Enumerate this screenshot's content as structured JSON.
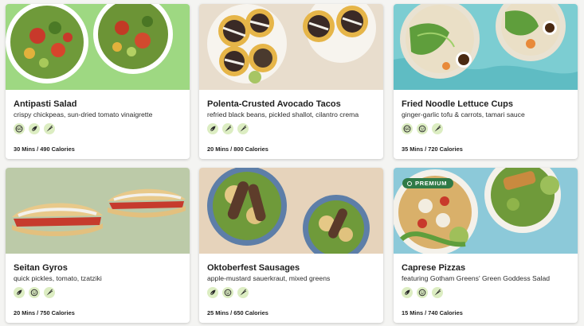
{
  "colors": {
    "icon_bg": "#dcedc2",
    "icon_fg": "#2b2b2b",
    "premium_badge": "#2f7a46"
  },
  "recipes": [
    {
      "title": "Antipasti Salad",
      "subtitle": "crispy chickpeas, sun-dried tomato vinaigrette",
      "meta": "30 Mins / 490 Calories",
      "icons": [
        "gluten-free-icon",
        "vegan-leaf-icon",
        "carrot-veggie-icon"
      ]
    },
    {
      "title": "Polenta-Crusted Avocado Tacos",
      "subtitle": "refried black beans, pickled shallot, cilantro crema",
      "meta": "20 Mins / 800 Calories",
      "icons": [
        "vegan-leaf-icon",
        "carrot-veggie-icon",
        "carrot-veggie-icon"
      ]
    },
    {
      "title": "Fried Noodle Lettuce Cups",
      "subtitle": "ginger-garlic tofu & carrots, tamari sauce",
      "meta": "35 Mins / 720 Calories",
      "icons": [
        "gluten-free-icon",
        "dairy-free-icon",
        "carrot-veggie-icon"
      ]
    },
    {
      "title": "Seitan Gyros",
      "subtitle": "quick pickles, tomato, tzatziki",
      "meta": "20 Mins / 750 Calories",
      "icons": [
        "vegan-leaf-icon",
        "dairy-free-icon",
        "carrot-veggie-icon"
      ]
    },
    {
      "title": "Oktoberfest Sausages",
      "subtitle": "apple-mustard sauerkraut, mixed greens",
      "meta": "25 Mins / 650 Calories",
      "icons": [
        "vegan-leaf-icon",
        "dairy-free-icon",
        "carrot-veggie-icon"
      ]
    },
    {
      "title": "Caprese Pizzas",
      "subtitle": "featuring Gotham Greens' Green Goddess Salad",
      "meta": "15 Mins / 740 Calories",
      "badge": "PREMIUM",
      "icons": [
        "vegan-leaf-icon",
        "dairy-free-icon",
        "carrot-veggie-icon"
      ]
    }
  ]
}
